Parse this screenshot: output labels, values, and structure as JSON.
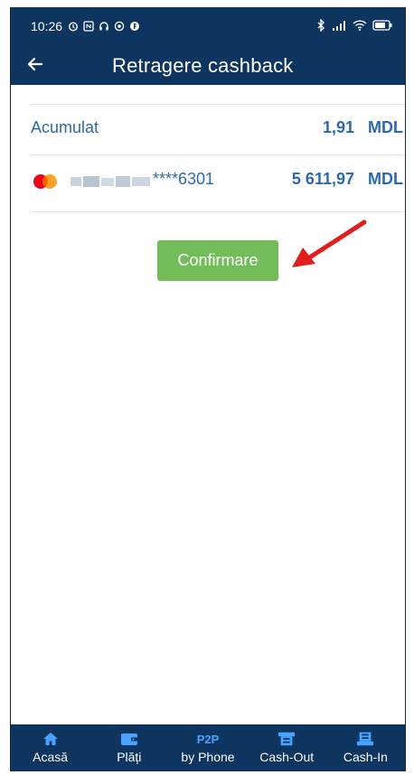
{
  "status_bar": {
    "time": "10:26"
  },
  "header": {
    "title": "Retragere cashback",
    "back_icon": "back-arrow-icon"
  },
  "accumulated": {
    "label": "Acumulat",
    "value": "1,91",
    "currency": "MDL"
  },
  "card": {
    "number_suffix": "****6301",
    "balance": "5 611,97",
    "currency": "MDL",
    "brand_icon": "mastercard-icon"
  },
  "confirm_button": {
    "label": "Confirmare"
  },
  "bottom_nav": {
    "items": [
      {
        "label": "Acasă",
        "icon": "home-icon"
      },
      {
        "label": "Plăți",
        "icon": "wallet-icon"
      },
      {
        "label": "by Phone",
        "icon_text": "P2P"
      },
      {
        "label": "Cash-Out",
        "icon": "cash-out-icon"
      },
      {
        "label": "Cash-In",
        "icon": "cash-in-icon"
      }
    ]
  },
  "colors": {
    "primary": "#0d3560",
    "accent_text": "#2e6aa8",
    "confirm": "#72bd5a",
    "annotation": "#e01e1e"
  }
}
